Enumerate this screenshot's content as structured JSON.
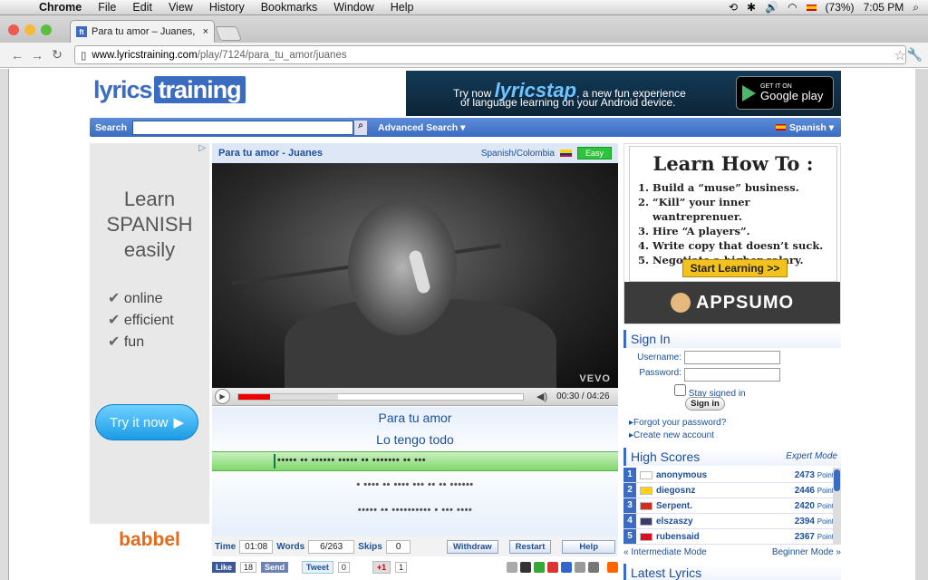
{
  "menubar": {
    "app": "Chrome",
    "items": [
      "File",
      "Edit",
      "View",
      "History",
      "Bookmarks",
      "Window",
      "Help"
    ],
    "battery": "(73%)",
    "clock": "7:05 PM"
  },
  "tab": {
    "title": "Para tu amor – Juanes, Music",
    "favicon": "ft"
  },
  "omnibox": {
    "domain": "www.lyricstraining.com",
    "path": "/play/7124/para_tu_amor/juanes"
  },
  "logo": {
    "a": "lyrics",
    "b": "training"
  },
  "banner": {
    "try": "Try now ",
    "brand": "lyricstap",
    "l1rest": ", a new fun experience",
    "l2": "of language learning on your Android device.",
    "get": "GET IT ON",
    "store": "Google play"
  },
  "search": {
    "label": "Search",
    "advanced": "Advanced Search ▾",
    "lang": "Spanish ▾"
  },
  "leftad": {
    "title_l1": "Learn",
    "title_l2": "SPANISH",
    "title_l3": "easily",
    "bullets": [
      "online",
      "efficient",
      "fun"
    ],
    "cta": "Try it now",
    "brand": "babbel"
  },
  "player": {
    "title": "Para tu amor - Juanes",
    "region": "Spanish/Colombia",
    "level": "Easy",
    "time": "00:30 / 04:26",
    "progress": 0.113,
    "buffered": 0.35,
    "vevo": "VEVO",
    "lyrics_prev1": "Para tu amor",
    "lyrics_prev2": "Lo tengo todo",
    "current": "••••• •• •••••• ••••• •• ••••••• •• •••",
    "next1": "• •••• •• •••• ••• •• •• ••••••",
    "next2": "••••• •• •••••••••• • ••• ••••"
  },
  "stats": {
    "time_label": "Time",
    "time": "01:08",
    "words_label": "Words",
    "words": "6/263",
    "skips_label": "Skips",
    "skips": "0",
    "withdraw": "Withdraw",
    "restart": "Restart",
    "help": "Help"
  },
  "social": {
    "like": "Like",
    "like_count": "18",
    "send": "Send",
    "tweet": "Tweet",
    "tweet_count": "0",
    "plus": "+1",
    "plus_count": "1"
  },
  "rightad": {
    "title": "Learn How To :",
    "items": [
      "Build a “muse” business.",
      "“Kill” your inner wantreprenuer.",
      "Hire “A players”.",
      "Write copy that doesn’t suck.",
      "Negotiate a higher salary."
    ],
    "cta": "Start Learning >>",
    "brand": "APPSUMO"
  },
  "signin": {
    "title": "Sign In",
    "username": "Username:",
    "password": "Password:",
    "stay": "Stay signed in",
    "button": "Sign in",
    "forgot": "▸Forgot your password?",
    "create": "▸Create new account"
  },
  "highscores": {
    "title": "High Scores",
    "mode": "Expert Mode",
    "unit": "Points",
    "rows": [
      {
        "n": "1",
        "name": "anonymous",
        "pts": "2473",
        "flag": "#ffffff"
      },
      {
        "n": "2",
        "name": "diegosnz",
        "pts": "2446",
        "flag": "#fcd116"
      },
      {
        "n": "3",
        "name": "Serpent.",
        "pts": "2420",
        "flag": "#d52b1e"
      },
      {
        "n": "4",
        "name": "elszaszy",
        "pts": "2394",
        "flag": "#3c3b6e"
      },
      {
        "n": "5",
        "name": "rubensaid",
        "pts": "2367",
        "flag": "#d91023"
      }
    ],
    "intermediate": "« Intermediate Mode",
    "beginner": "Beginner Mode »"
  },
  "latest": "Latest Lyrics"
}
